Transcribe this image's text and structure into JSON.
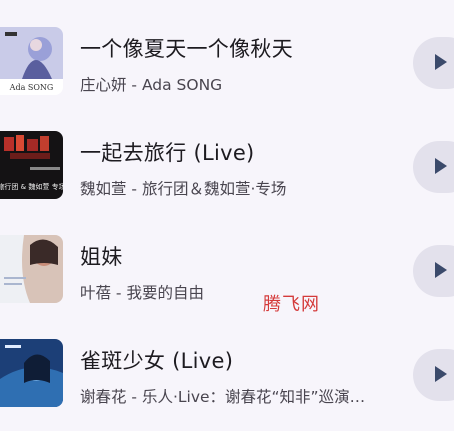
{
  "songs": [
    {
      "title": "一个像夏天一个像秋天",
      "subtitle": "庄心妍 - Ada SONG",
      "cover_text": "Ada SONG"
    },
    {
      "title": "一起去旅行 (Live)",
      "subtitle": "魏如萱 - 旅行团＆魏如萱·专场",
      "cover_text": "旅行团 & 魏如萱 专场"
    },
    {
      "title": "姐妹",
      "subtitle": "叶蓓 - 我要的自由",
      "cover_text": ""
    },
    {
      "title": "雀斑少女 (Live)",
      "subtitle": "谢春花 - 乐人·Live：谢春花“知非”巡演…",
      "cover_text": ""
    }
  ],
  "watermark": "腾飞网",
  "colors": {
    "background": "#f7f5fb",
    "play_button": "#e3e1ec",
    "play_icon": "#3b4a6b",
    "watermark": "#d43a3a"
  },
  "icons": {
    "play": "play-icon"
  }
}
